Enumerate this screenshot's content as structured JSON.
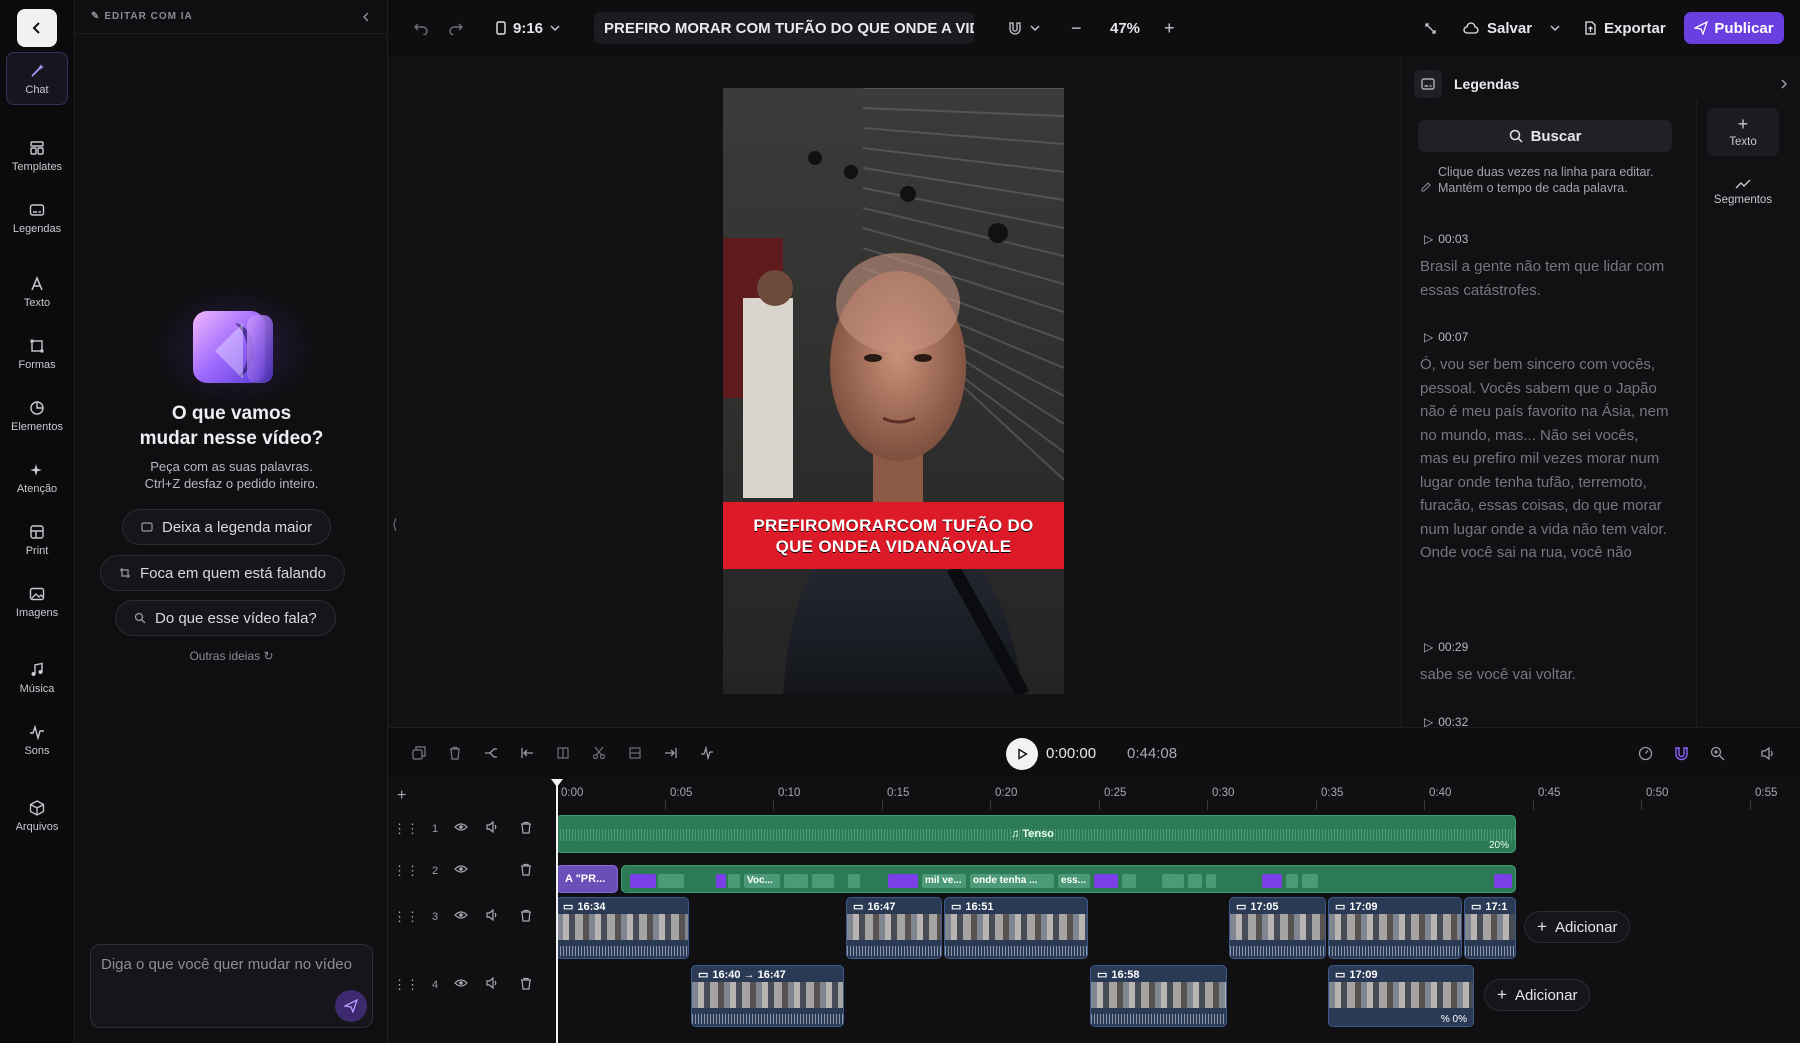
{
  "rail": {
    "items": [
      {
        "label": "Chat",
        "icon": "magic-wand-icon"
      },
      {
        "label": "Templates",
        "icon": "templates-icon"
      },
      {
        "label": "Legendas",
        "icon": "captions-icon"
      },
      {
        "label": "Texto",
        "icon": "text-icon"
      },
      {
        "label": "Formas",
        "icon": "shapes-icon"
      },
      {
        "label": "Elementos",
        "icon": "elements-icon"
      },
      {
        "label": "Atenção",
        "icon": "sparkle-icon"
      },
      {
        "label": "Print",
        "icon": "print-icon"
      },
      {
        "label": "Imagens",
        "icon": "image-icon"
      },
      {
        "label": "Música",
        "icon": "music-icon"
      },
      {
        "label": "Sons",
        "icon": "sound-icon"
      },
      {
        "label": "Arquivos",
        "icon": "box-icon"
      }
    ]
  },
  "ai": {
    "header": "EDITAR COM IA",
    "title_line1": "O que vamos",
    "title_line2": "mudar nesse vídeo?",
    "sub_line1": "Peça com as suas palavras.",
    "sub_line2": "Ctrl+Z desfaz o pedido inteiro.",
    "chips": [
      "Deixa a legenda maior",
      "Foca em quem está falando",
      "Do que esse vídeo fala?"
    ],
    "other_ideas": "Outras ideias",
    "prompt_placeholder": "Diga o que você quer mudar no vídeo"
  },
  "topbar": {
    "aspect": "9:16",
    "title": "PREFIRO MORAR COM TUFÃO DO QUE ONDE A VID...",
    "zoom": "47%",
    "save": "Salvar",
    "export": "Exportar",
    "publish": "Publicar"
  },
  "preview": {
    "caption_line1": "PREFIROMORARCOM TUFÃO DO",
    "caption_line2": "QUE ONDEA VIDANÃOVALE"
  },
  "subs": {
    "title": "Legendas",
    "search": "Buscar",
    "hint": "Clique duas vezes na linha para editar. Mantém o tempo de cada palavra.",
    "segments": [
      {
        "time": "00:03",
        "text": "Brasil a gente não tem que lidar com essas catástrofes."
      },
      {
        "time": "00:07",
        "text": "Ó, vou ser bem sincero com vocês, pessoal. Vocês sabem que o Japão não é meu país favorito na Ásia, nem no mundo, mas... Não sei vocês, mas eu prefiro mil vezes morar num lugar onde tenha tufão, terremoto, furacão, essas coisas, do que morar num lugar onde a vida não tem valor. Onde você sai na rua, você não"
      },
      {
        "time": "00:29",
        "text": "sabe se você vai voltar."
      },
      {
        "time": "00:32",
        "text": ""
      }
    ],
    "side": [
      {
        "label": "Texto"
      },
      {
        "label": "Segmentos"
      }
    ]
  },
  "timeline": {
    "current": "0:00:00",
    "total": "0:44:08",
    "ruler": [
      "0:00",
      "0:05",
      "0:10",
      "0:15",
      "0:20",
      "0:25",
      "0:30",
      "0:35",
      "0:40",
      "0:45",
      "0:50",
      "0:55"
    ],
    "tracks": [
      "1",
      "2",
      "3",
      "4"
    ],
    "music_label": "Tenso",
    "music_percent": "20%",
    "caption_clip_label": "\"PR...",
    "caption_words": [
      "Voc...",
      "mil ve...",
      "onde tenha ...",
      "ess..."
    ],
    "track3_clips": [
      "16:34",
      "16:47",
      "16:51",
      "17:05",
      "17:09",
      "17:1"
    ],
    "track4_clips": [
      "16:40 → 16:47",
      "16:58",
      "17:09"
    ],
    "track4_percent": "0%",
    "add_label": "Adicionar"
  }
}
